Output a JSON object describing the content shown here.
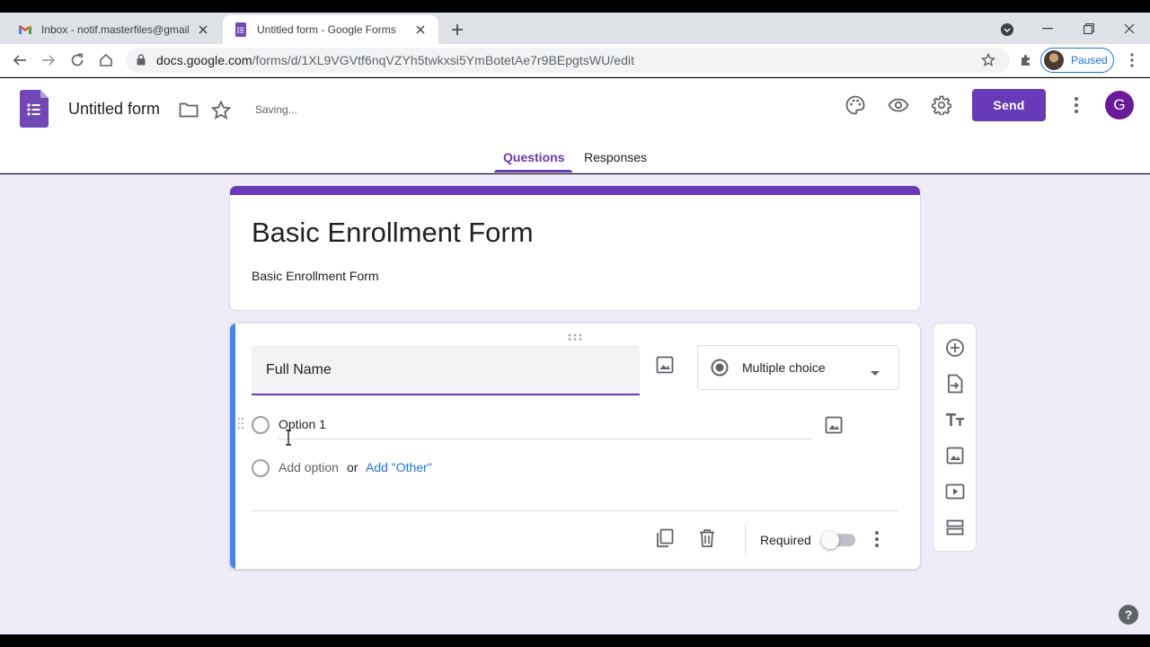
{
  "browser": {
    "tabs": [
      {
        "title": "Inbox - notif.masterfiles@gmail.c",
        "favicon": "gmail-icon",
        "active": false
      },
      {
        "title": "Untitled form - Google Forms",
        "favicon": "forms-icon",
        "active": true
      }
    ],
    "url_host": "docs.google.com",
    "url_path": "/forms/d/1XL9VGVtf6nqVZYh5twkxsi5YmBotetAe7r9BEpgtsWU/edit",
    "profile_status": "Paused"
  },
  "forms_header": {
    "doc_title": "Untitled form",
    "save_status": "Saving...",
    "send_label": "Send",
    "account_initial": "G",
    "tabs": {
      "questions": "Questions",
      "responses": "Responses"
    }
  },
  "form": {
    "title": "Basic Enrollment Form",
    "description": "Basic Enrollment Form",
    "accent_color": "#673ab7"
  },
  "question": {
    "text": "Full Name",
    "type": "Multiple choice",
    "options": [
      "Option 1"
    ],
    "add_option": "Add option",
    "or": "or",
    "add_other": "Add \"Other\"",
    "required_label": "Required",
    "required": false
  },
  "side_toolbar": [
    "add-question-icon",
    "import-questions-icon",
    "add-title-icon",
    "add-image-icon",
    "add-video-icon",
    "add-section-icon"
  ],
  "help": "?"
}
